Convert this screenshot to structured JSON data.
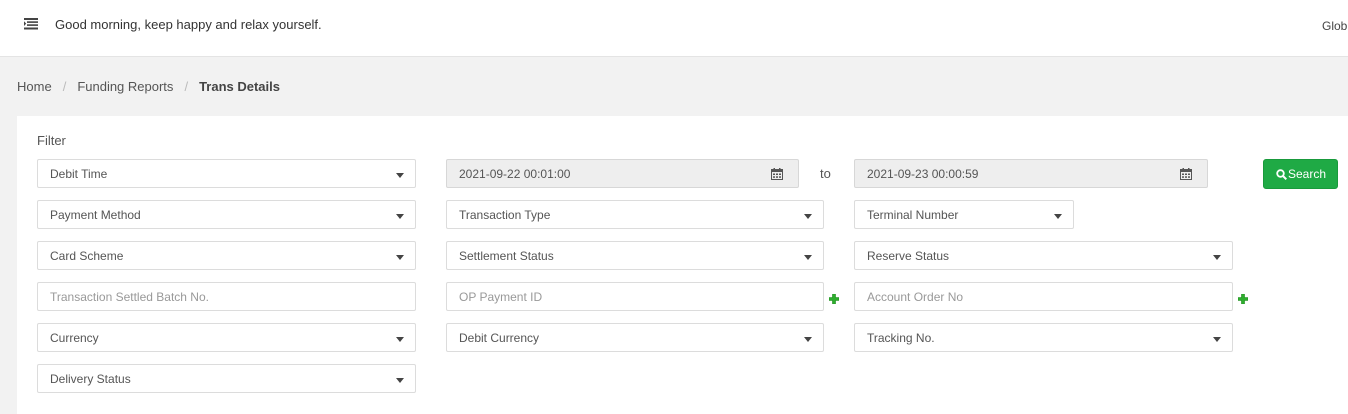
{
  "header": {
    "greeting": "Good morning, keep happy and relax yourself.",
    "right_text": "Glob",
    "menu_icon": "menu-list-icon"
  },
  "breadcrumb": {
    "items": [
      "Home",
      "Funding Reports"
    ],
    "current": "Trans Details",
    "separator": "/"
  },
  "filter": {
    "title": "Filter",
    "time_type": "Debit Time",
    "date_from": "2021-09-22 00:01:00",
    "date_to": "2021-09-23 00:00:59",
    "to_label": "to",
    "search_label": "Search",
    "payment_method": "Payment Method",
    "transaction_type": "Transaction Type",
    "terminal_number": "Terminal Number",
    "card_scheme": "Card Scheme",
    "settlement_status": "Settlement Status",
    "reserve_status": "Reserve Status",
    "batch_no_placeholder": "Transaction Settled Batch No.",
    "op_payment_id_placeholder": "OP Payment ID",
    "account_order_no_placeholder": "Account Order No",
    "currency": "Currency",
    "debit_currency": "Debit Currency",
    "tracking_no": "Tracking No.",
    "delivery_status": "Delivery Status"
  },
  "colors": {
    "accent": "#1faa45",
    "plus": "#2eae2e"
  }
}
